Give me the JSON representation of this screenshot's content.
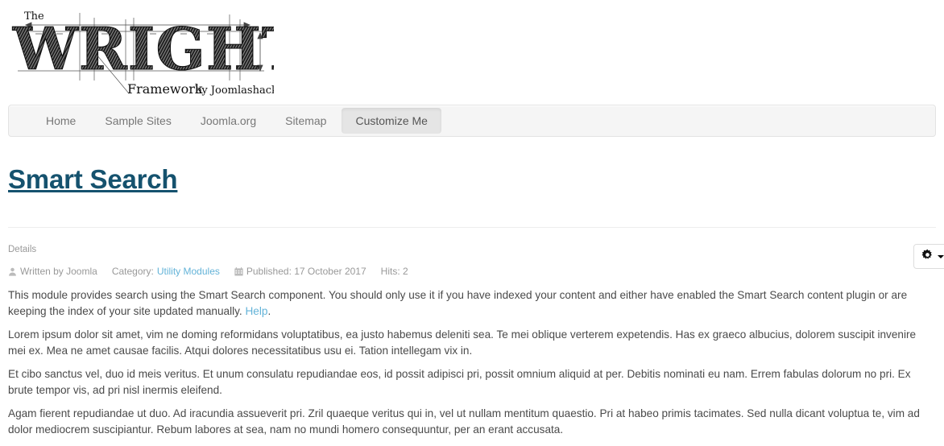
{
  "site": {
    "logo": {
      "the": "The",
      "wordmark": "WRIGHT",
      "tagline_main": "Framework",
      "tagline_sub": "by Joomlashack"
    }
  },
  "nav": {
    "items": [
      {
        "label": "Home",
        "active": false
      },
      {
        "label": "Sample Sites",
        "active": false
      },
      {
        "label": "Joomla.org",
        "active": false
      },
      {
        "label": "Sitemap",
        "active": false
      },
      {
        "label": "Customize Me",
        "active": true
      }
    ]
  },
  "article": {
    "title": "Smart Search",
    "details_label": "Details",
    "info": {
      "author_icon": "user-icon",
      "author": "Written by Joomla",
      "category_label": "Category:",
      "category_link": "Utility Modules",
      "published_icon": "calendar-icon",
      "published": "Published: 17 October 2017",
      "hits": "Hits: 2"
    },
    "actions": {
      "gear_icon": "gear-icon",
      "caret_icon": "chevron-down-icon"
    },
    "paragraphs": [
      {
        "lines": [
          "This module provides search using the Smart Search component. You should only use it if you have indexed your content and either have enabled the Smart Search content plugin or are",
          "keeping the index of your site updated manually. "
        ],
        "link": "Help",
        "link_suffix": "."
      },
      {
        "lines": [
          "Lorem ipsum dolor sit amet, vim ne doming reformidans voluptatibus, ea justo habemus deleniti sea. Te mei oblique verterem expetendis. Has ex graeco albucius, dolorem suscipit invenire",
          "mei ex. Mea ne amet causae facilis. Atqui dolores necessitatibus usu ei. Tation intellegam vix in."
        ]
      },
      {
        "lines": [
          "Et cibo sanctus vel, duo id meis veritus. Et unum consulatu repudiandae eos, id possit adipisci pri, possit omnium aliquid at per. Debitis nominati eu nam. Errem fabulas dolorum no pri. Ex",
          "brute tempor vis, ad pri nisl inermis eleifend."
        ]
      },
      {
        "lines": [
          "Agam fierent repudiandae ut duo. Ad iracundia assueverit pri. Zril quaeque veritus qui in, vel ut nullam mentitum quaestio. Pri at habeo primis tacimates. Sed nulla dicant voluptua te, vim ad",
          "dolor mediocrem suscipiantur. Rebum labores at sea, nam no mundi homero consequuntur, per an erant accusata."
        ]
      }
    ]
  },
  "colors": {
    "title_link": "#15526e",
    "body_link": "#63b3d8",
    "meta_text": "#999999",
    "nav_text": "#777777",
    "nav_bg": "#f5f5f5",
    "nav_active_bg": "#e5e5e5"
  }
}
